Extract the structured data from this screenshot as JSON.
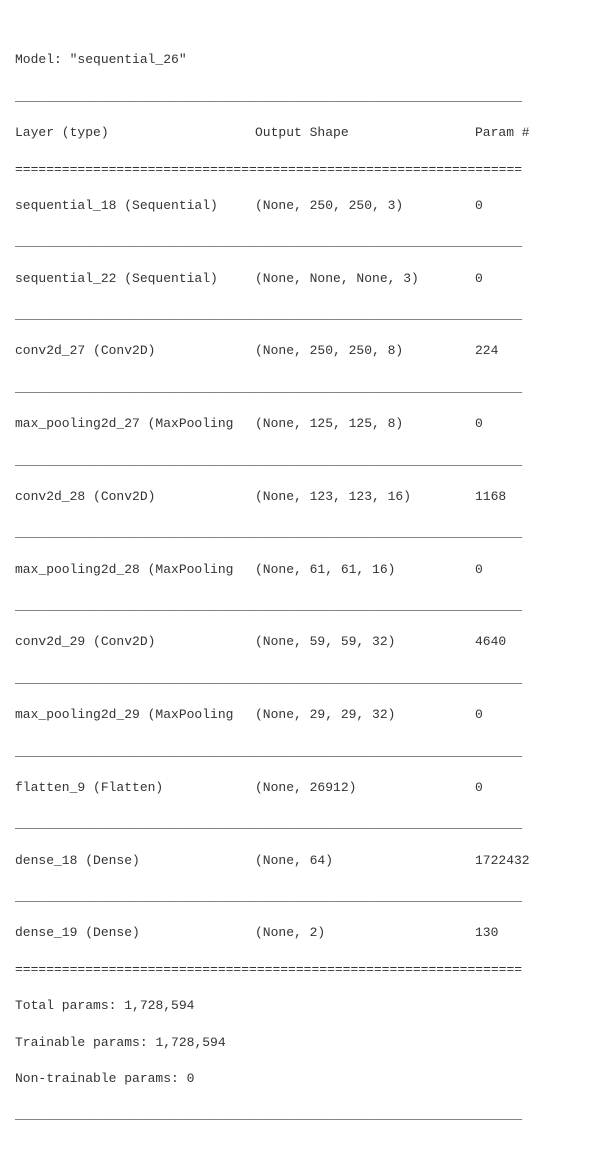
{
  "model_name": "sequential_26",
  "headers": {
    "layer": "Layer (type)",
    "output_shape": "Output Shape",
    "param": "Param #"
  },
  "rules": {
    "single": "_________________________________________________________________",
    "double": "================================================================="
  },
  "layers": [
    {
      "name": "sequential_18 (Sequential)",
      "shape": "(None, 250, 250, 3)",
      "params": "0"
    },
    {
      "name": "sequential_22 (Sequential)",
      "shape": "(None, None, None, 3)",
      "params": "0"
    },
    {
      "name": "conv2d_27 (Conv2D)",
      "shape": "(None, 250, 250, 8)",
      "params": "224"
    },
    {
      "name": "max_pooling2d_27 (MaxPooling",
      "shape": "(None, 125, 125, 8)",
      "params": "0"
    },
    {
      "name": "conv2d_28 (Conv2D)",
      "shape": "(None, 123, 123, 16)",
      "params": "1168"
    },
    {
      "name": "max_pooling2d_28 (MaxPooling",
      "shape": "(None, 61, 61, 16)",
      "params": "0"
    },
    {
      "name": "conv2d_29 (Conv2D)",
      "shape": "(None, 59, 59, 32)",
      "params": "4640"
    },
    {
      "name": "max_pooling2d_29 (MaxPooling",
      "shape": "(None, 29, 29, 32)",
      "params": "0"
    },
    {
      "name": "flatten_9 (Flatten)",
      "shape": "(None, 26912)",
      "params": "0"
    },
    {
      "name": "dense_18 (Dense)",
      "shape": "(None, 64)",
      "params": "1722432"
    },
    {
      "name": "dense_19 (Dense)",
      "shape": "(None, 2)",
      "params": "130"
    }
  ],
  "summary": {
    "total_label": "Total params:",
    "total_params": "1,728,594",
    "trainable_label": "Trainable params:",
    "trainable_params": "1,728,594",
    "non_trainable_label": "Non-trainable params:",
    "non_trainable_params": "0"
  }
}
